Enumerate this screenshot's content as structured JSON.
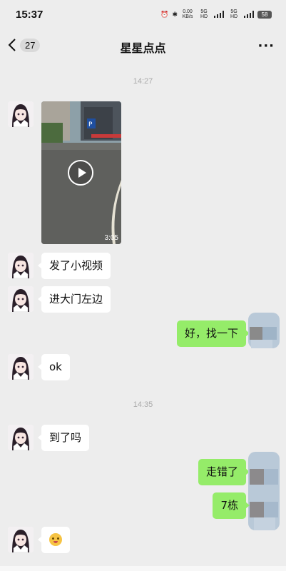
{
  "status_bar": {
    "time": "15:37",
    "net_speed": "0.00 KB/s",
    "net1": "5G HD",
    "net2": "5G HD",
    "battery": "58"
  },
  "header": {
    "unread_count": "27",
    "title": "星星点点",
    "more": "···"
  },
  "messages": {
    "ts1": "14:27",
    "video_duration": "3:05",
    "m1": "发了小视频",
    "m2": "进大门左边",
    "m3": "好，找一下",
    "m4": "ok",
    "ts2": "14:35",
    "m5": "到了吗",
    "m6": "走错了",
    "m7": "7栋"
  },
  "colors": {
    "accent": "#95ec69",
    "background": "#ededed"
  },
  "icons": [
    "back-icon",
    "more-icon",
    "play-icon",
    "blushing-face-emoji"
  ]
}
